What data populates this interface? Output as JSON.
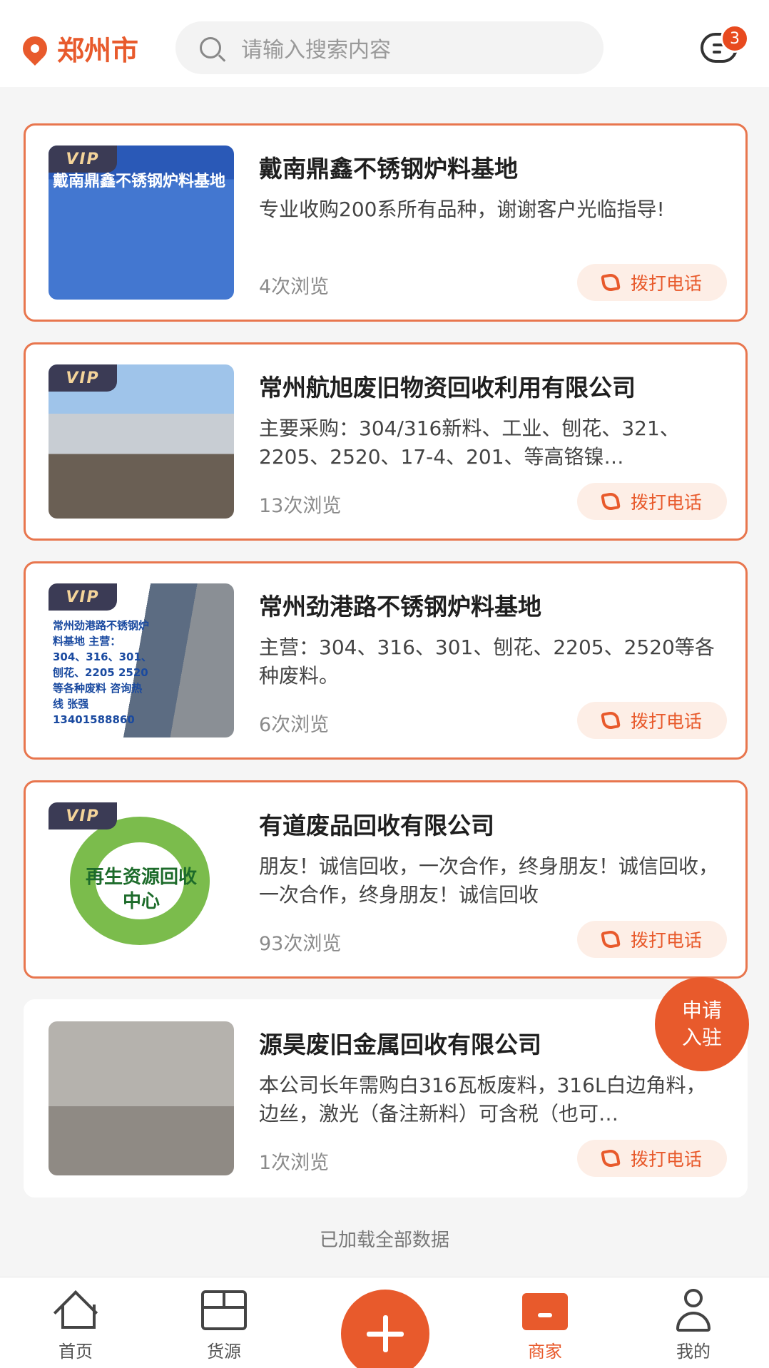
{
  "header": {
    "city": "郑州市",
    "search_placeholder": "请输入搜索内容",
    "message_count": "3"
  },
  "merchants": [
    {
      "vip": "VIP",
      "image_text": "戴南鼎鑫不锈钢炉料基地",
      "name": "戴南鼎鑫不锈钢炉料基地",
      "description": "专业收购200系所有品种，谢谢客户光临指导!",
      "views": "4次浏览",
      "call_label": "拨打电话"
    },
    {
      "vip": "VIP",
      "image_text": "",
      "name": "常州航旭废旧物资回收利用有限公司",
      "description": "主要采购：304/316新料、工业、刨花、321、2205、2520、17-4、201、等高铬镍…",
      "views": "13次浏览",
      "call_label": "拨打电话"
    },
    {
      "vip": "VIP",
      "image_text": "常州劲港路不锈钢炉料基地 主营：304、316、301、刨花、2205 2520等各种废料 咨询热线 张强13401588860",
      "name": "常州劲港路不锈钢炉料基地",
      "description": "主营：304、316、301、刨花、2205、2520等各种废料。",
      "views": "6次浏览",
      "call_label": "拨打电话"
    },
    {
      "vip": "VIP",
      "image_text": "再生资源回收中心",
      "name": "有道废品回收有限公司",
      "description": "朋友！诚信回收，一次合作，终身朋友！诚信回收，一次合作，终身朋友！诚信回收",
      "views": "93次浏览",
      "call_label": "拨打电话"
    },
    {
      "vip": "",
      "image_text": "",
      "name": "源昊废旧金属回收有限公司",
      "description": "本公司长年需购白316瓦板废料，316L白边角料，边丝，激光（备注新料）可含税（也可…",
      "views": "1次浏览",
      "call_label": "拨打电话"
    }
  ],
  "join_button": {
    "line1": "申请",
    "line2": "入驻"
  },
  "footer_text": "已加载全部数据",
  "tabs": [
    {
      "label": "首页",
      "icon": "home-icon"
    },
    {
      "label": "货源",
      "icon": "box-icon"
    },
    {
      "label": "",
      "icon": "plus-icon"
    },
    {
      "label": "商家",
      "icon": "shop-icon"
    },
    {
      "label": "我的",
      "icon": "user-icon"
    }
  ],
  "colors": {
    "accent": "#e85a2c",
    "vip_bg": "#3b3b55",
    "vip_text": "#f4d49a"
  }
}
